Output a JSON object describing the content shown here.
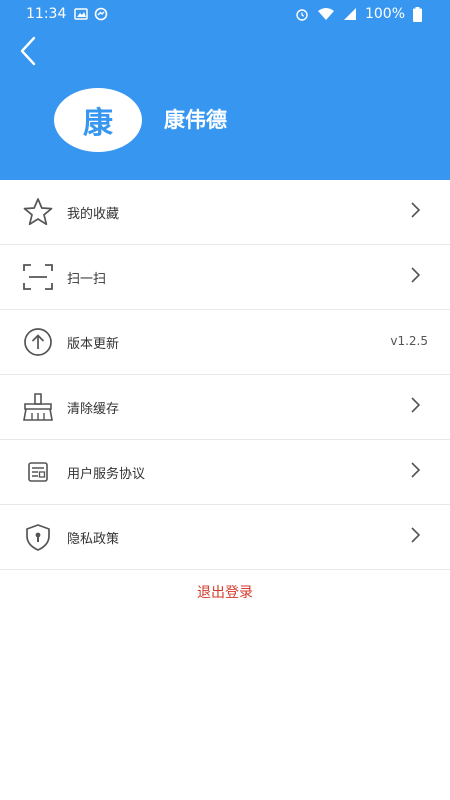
{
  "status_bar": {
    "time": "11:34",
    "battery": "100%"
  },
  "profile": {
    "avatar_char": "康",
    "name": "康伟德"
  },
  "menu": [
    {
      "label": "我的收藏",
      "icon": "star-icon"
    },
    {
      "label": "扫一扫",
      "icon": "scan-icon"
    },
    {
      "label": "版本更新",
      "icon": "upload-circle-icon",
      "value": "v1.2.5"
    },
    {
      "label": "清除缓存",
      "icon": "broom-icon"
    },
    {
      "label": "用户服务协议",
      "icon": "agreement-icon"
    },
    {
      "label": "隐私政策",
      "icon": "shield-lock-icon"
    }
  ],
  "logout_label": "退出登录",
  "colors": {
    "primary": "#3696f0",
    "logout": "#d43b2c"
  }
}
